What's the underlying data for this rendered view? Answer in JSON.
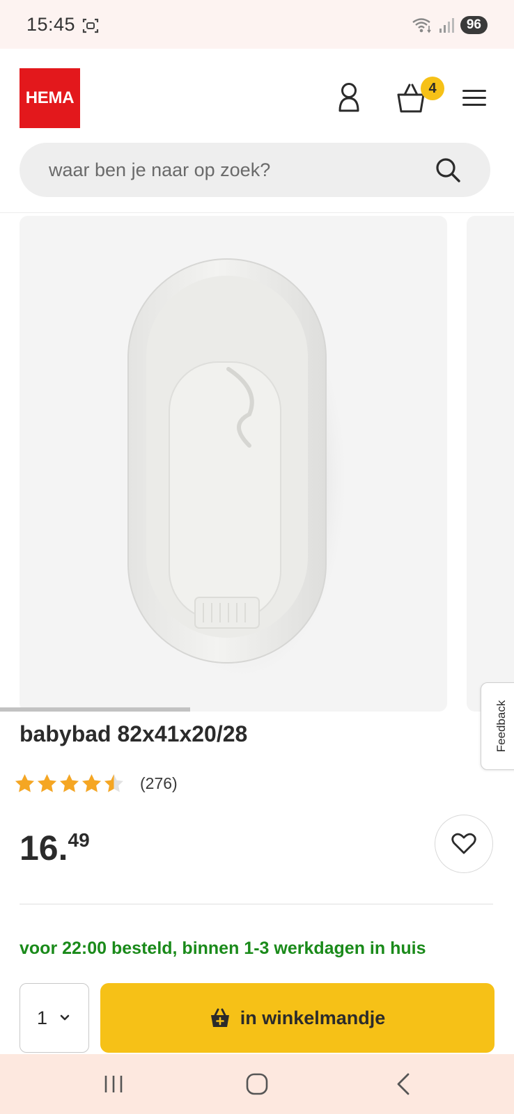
{
  "status_bar": {
    "time": "15:45",
    "battery": "96",
    "icons": [
      "screenshot-icon",
      "wifi-icon",
      "signal-icon"
    ]
  },
  "header": {
    "logo_text": "HEMA",
    "cart_count": "4",
    "icons": [
      "account-icon",
      "basket-icon",
      "menu-icon"
    ]
  },
  "search": {
    "placeholder": "waar ben je naar op zoek?",
    "value": ""
  },
  "gallery": {
    "image_subject": "white baby bath tub",
    "progress_fraction": 0.37
  },
  "feedback": {
    "label": "Feedback"
  },
  "product": {
    "title": "babybad 82x41x20/28",
    "rating": 4.5,
    "rating_max": 5,
    "review_count": "(276)",
    "price_main": "16",
    "price_separator": ".",
    "price_cents": "49"
  },
  "delivery": {
    "text": "voor 22:00 besteld, binnen 1-3 werkdagen in huis"
  },
  "purchase": {
    "quantity": "1",
    "add_to_cart_label": "in winkelmandje"
  },
  "colors": {
    "brand_red": "#e3181c",
    "accent_yellow": "#f6c117",
    "delivery_green": "#1a8a1a",
    "star_orange": "#f5a623"
  }
}
